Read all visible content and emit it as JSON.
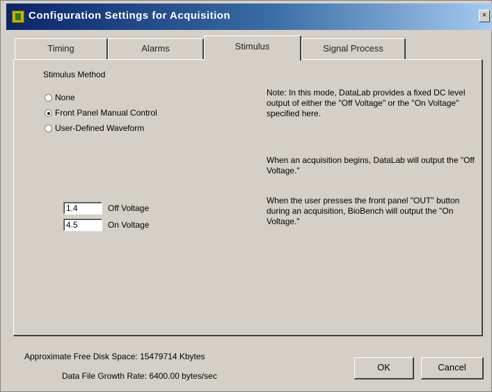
{
  "window": {
    "title": "Configuration Settings for Acquisition",
    "close_glyph": "×"
  },
  "tabs": [
    {
      "label": "Timing",
      "active": false
    },
    {
      "label": "Alarms",
      "active": false
    },
    {
      "label": "Stimulus",
      "active": true
    },
    {
      "label": "Signal Process",
      "active": false
    }
  ],
  "stimulus": {
    "method_label": "Stimulus Method",
    "options": [
      {
        "label": "None",
        "checked": false
      },
      {
        "label": "Front Panel Manual Control",
        "checked": true
      },
      {
        "label": "User-Defined Waveform",
        "checked": false
      }
    ],
    "note_paragraphs": [
      "Note: In this mode, DataLab provides a fixed DC level output of either the \"Off Voltage\" or the \"On Voltage\" specified here.",
      "When an acquisition begins, DataLab will output the \"Off Voltage.\"",
      "When the user presses the front panel \"OUT\" button during an acquisition, BioBench will output the \"On Voltage.\""
    ],
    "off_voltage": {
      "value": "1.4",
      "label": "Off Voltage"
    },
    "on_voltage": {
      "value": "4.5",
      "label": "On Voltage"
    }
  },
  "footer": {
    "free_disk_label": "Approximate Free Disk Space:",
    "free_disk_value": "15479714",
    "free_disk_unit": "Kbytes",
    "growth_label": "Data File Growth Rate:",
    "growth_value": "6400.00",
    "growth_unit": "bytes/sec",
    "ok_label": "OK",
    "cancel_label": "Cancel"
  },
  "colors": {
    "titlebar_start": "#0a246a",
    "titlebar_end": "#a6caf0",
    "face": "#d4d0c8"
  }
}
